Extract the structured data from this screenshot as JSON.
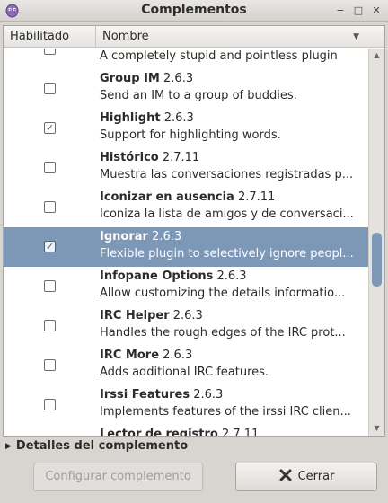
{
  "window": {
    "title": "Complementos",
    "app_icon": "pidgin-icon",
    "controls": [
      "minimize-icon",
      "maximize-icon",
      "close-icon"
    ]
  },
  "columns": {
    "enabled_label": "Habilitado",
    "name_label": "Nombre"
  },
  "plugins": [
    {
      "name": "",
      "version": "",
      "description": "A completely stupid and pointless plugin",
      "enabled": false,
      "selected": false
    },
    {
      "name": "Group IM",
      "version": "2.6.3",
      "description": "Send an IM to a group of buddies.",
      "enabled": false,
      "selected": false
    },
    {
      "name": "Highlight",
      "version": "2.6.3",
      "description": "Support for highlighting words.",
      "enabled": true,
      "selected": false
    },
    {
      "name": "Histórico",
      "version": "2.7.11",
      "description": "Muestra las conversaciones registradas p...",
      "enabled": false,
      "selected": false
    },
    {
      "name": "Iconizar en ausencia",
      "version": "2.7.11",
      "description": "Iconiza la lista de amigos y de conversaci...",
      "enabled": false,
      "selected": false
    },
    {
      "name": "Ignorar",
      "version": "2.6.3",
      "description": "Flexible plugin to selectively ignore peopl...",
      "enabled": true,
      "selected": true
    },
    {
      "name": "Infopane Options",
      "version": "2.6.3",
      "description": "Allow customizing the details informatio...",
      "enabled": false,
      "selected": false
    },
    {
      "name": "IRC Helper",
      "version": "2.6.3",
      "description": "Handles the rough edges of the IRC prot...",
      "enabled": false,
      "selected": false
    },
    {
      "name": "IRC More",
      "version": "2.6.3",
      "description": "Adds additional IRC features.",
      "enabled": false,
      "selected": false
    },
    {
      "name": "Irssi Features",
      "version": "2.6.3",
      "description": "Implements features of the irssi IRC clien...",
      "enabled": false,
      "selected": false
    },
    {
      "name": "Lector de registro",
      "version": "2.7.11",
      "description": "",
      "enabled": false,
      "selected": false
    }
  ],
  "details_expander": "Detalles del complemento",
  "buttons": {
    "configure": "Configurar complemento",
    "close": "Cerrar"
  },
  "colors": {
    "selection": "#7d97b6",
    "background": "#d8d5d1"
  }
}
